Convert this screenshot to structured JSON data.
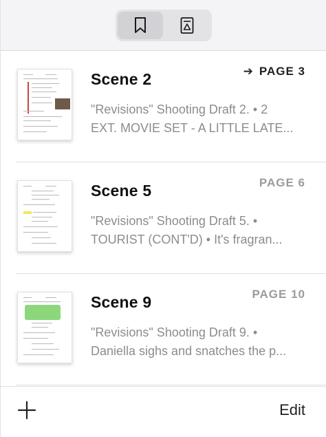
{
  "toolbar": {
    "segments": [
      {
        "icon": "bookmark-icon",
        "selected": true
      },
      {
        "icon": "document-outline-icon",
        "selected": false
      }
    ]
  },
  "bookmarks": [
    {
      "title": "Scene 2",
      "page": "PAGE 3",
      "current": true,
      "line1": "\"Revisions\" Shooting Draft 2. • 2",
      "line2": "EXT. MOVIE SET - A LITTLE LATE..."
    },
    {
      "title": "Scene 5",
      "page": "PAGE 6",
      "current": false,
      "line1": "\"Revisions\" Shooting Draft 5. •",
      "line2": "TOURIST (CONT'D) • It's fragran..."
    },
    {
      "title": "Scene 9",
      "page": "PAGE 10",
      "current": false,
      "line1": "\"Revisions\" Shooting Draft 9. •",
      "line2": "Daniella sighs and snatches the p..."
    }
  ],
  "bottombar": {
    "edit_label": "Edit"
  },
  "colors": {
    "accent_text": "#222222",
    "secondary_text": "#8c8c8c",
    "page_inactive": "#9b9b9b"
  }
}
